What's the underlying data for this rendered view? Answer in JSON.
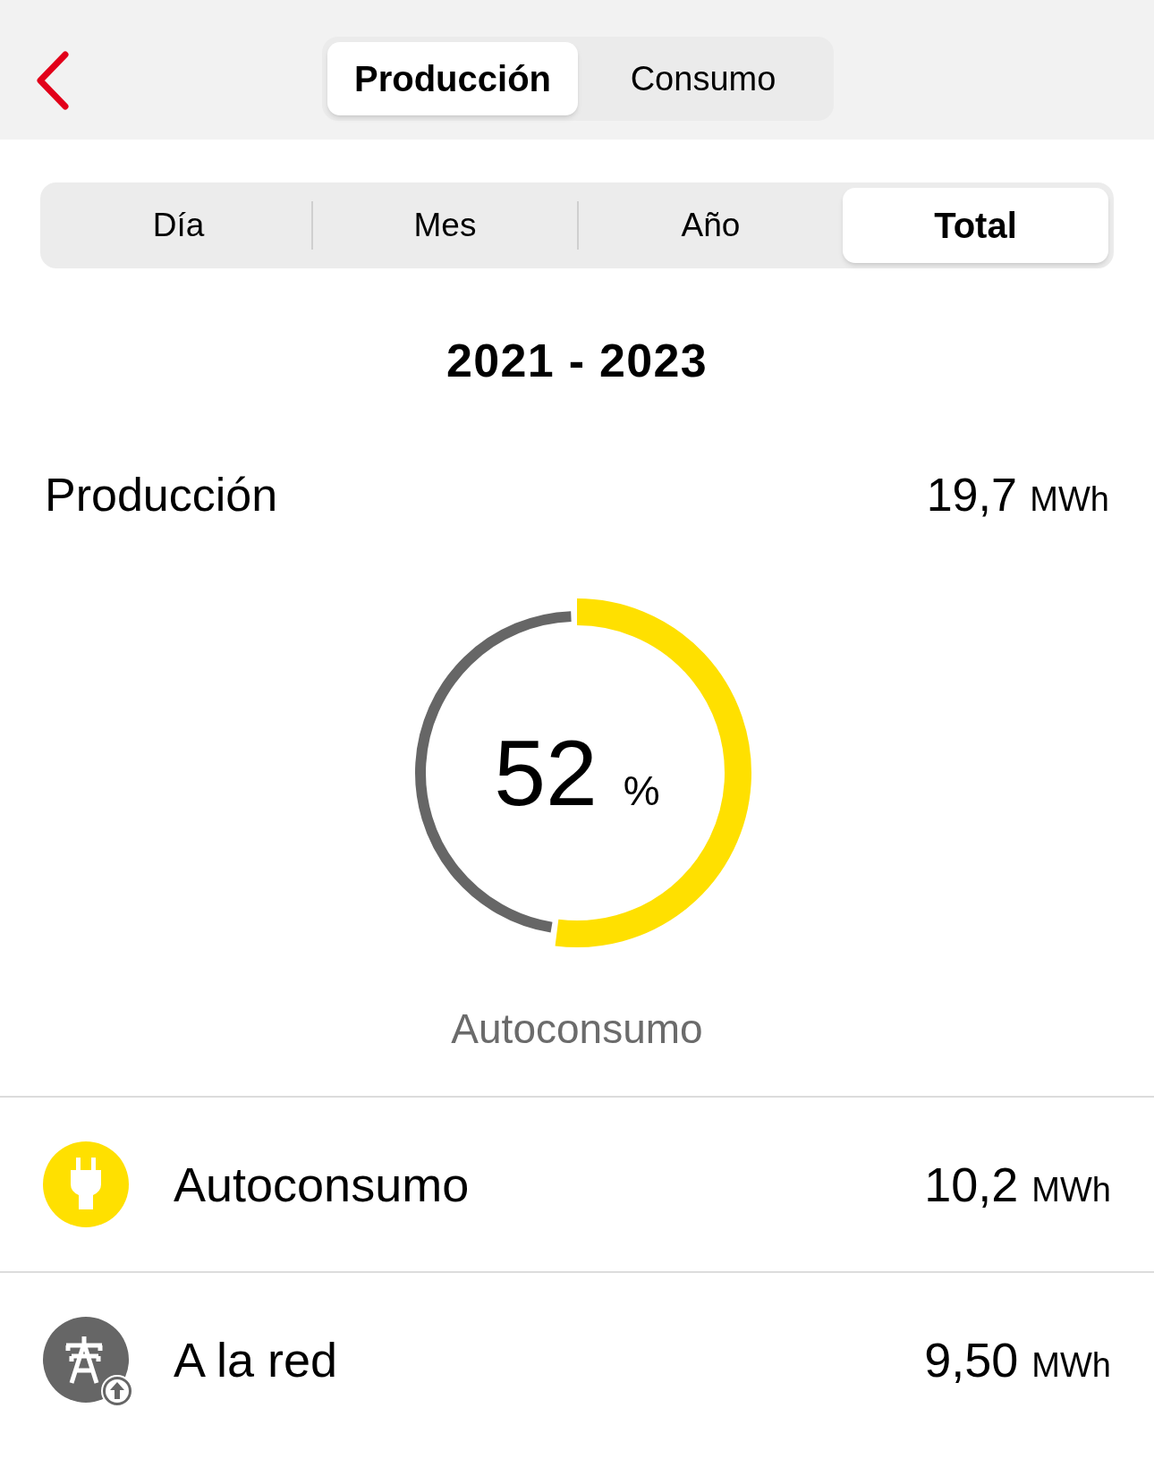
{
  "header": {
    "tabs": [
      {
        "label": "Producción",
        "selected": true
      },
      {
        "label": "Consumo",
        "selected": false
      }
    ]
  },
  "periods": [
    {
      "label": "Día",
      "selected": false
    },
    {
      "label": "Mes",
      "selected": false
    },
    {
      "label": "Año",
      "selected": false
    },
    {
      "label": "Total",
      "selected": true
    }
  ],
  "range": "2021 - 2023",
  "summary": {
    "label": "Producción",
    "value": "19,7",
    "unit": "MWh"
  },
  "gauge": {
    "reading": "52",
    "unit": "%",
    "caption": "Autoconsumo"
  },
  "rows": [
    {
      "kind": "plug",
      "label": "Autoconsumo",
      "value": "10,2",
      "unit": "MWh",
      "color": "#ffe000"
    },
    {
      "kind": "grid",
      "label": "A la red",
      "value": "9,50",
      "unit": "MWh",
      "color": "#666666"
    }
  ]
}
